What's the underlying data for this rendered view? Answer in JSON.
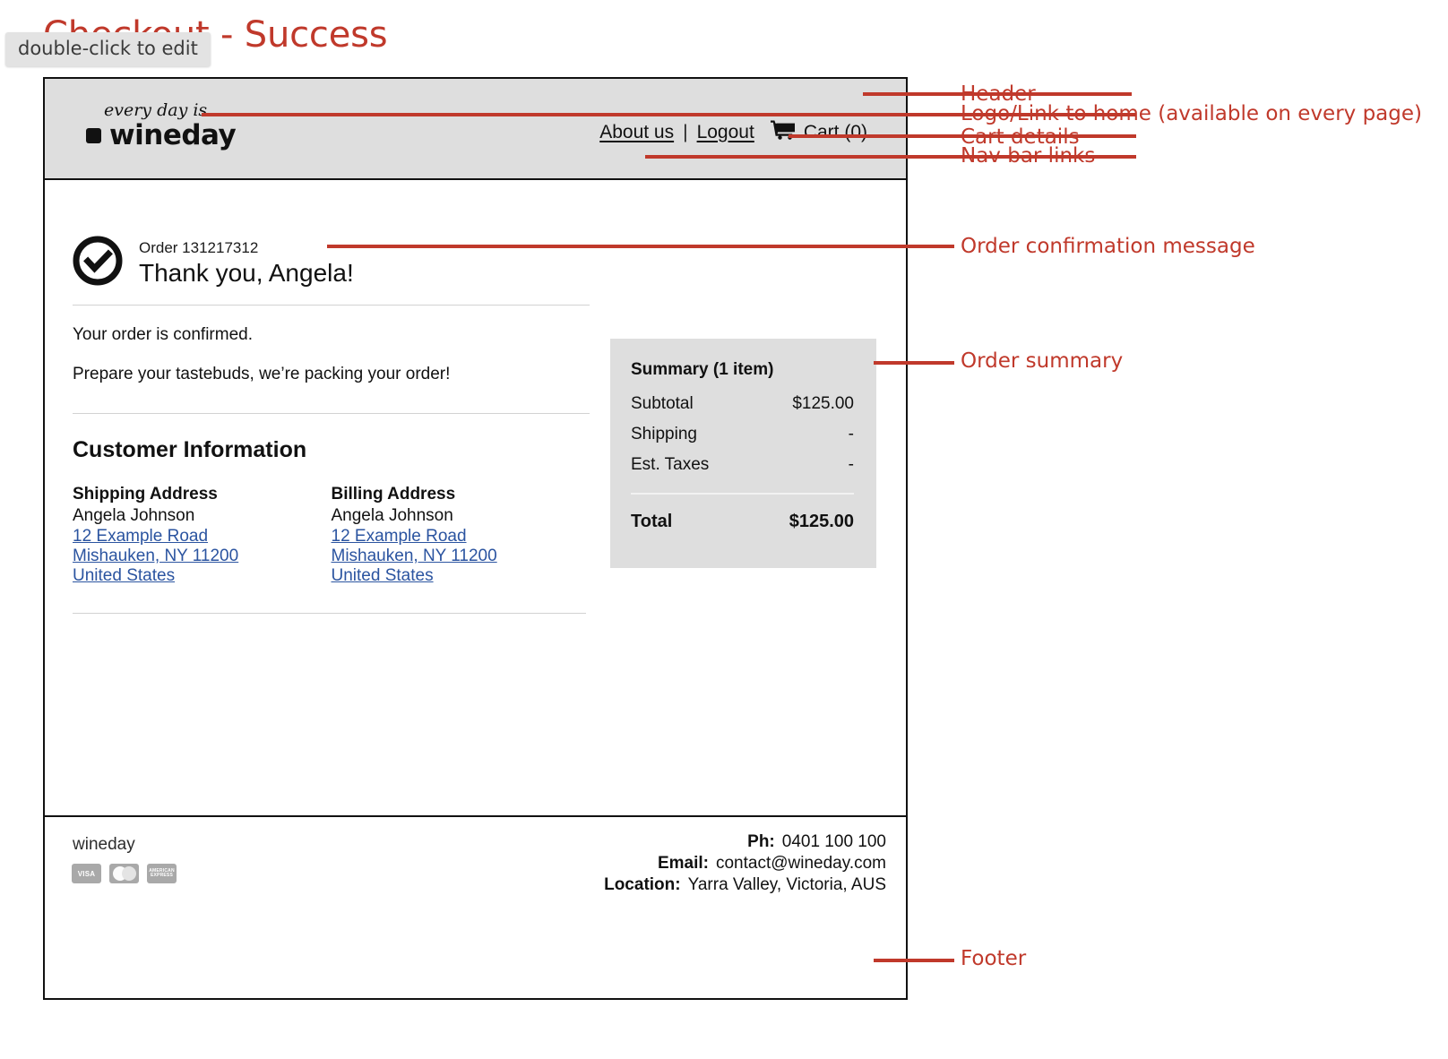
{
  "page": {
    "title": "Checkout - Success",
    "edit_hint": "double-click to edit",
    "accent_color": "#c0392b",
    "header_bg": "#dedede",
    "link_color": "#2b54a0"
  },
  "header": {
    "logo": {
      "tagline": "every day is",
      "wordmark": "wineday",
      "mark": "black-rounded-square"
    },
    "nav": {
      "about_label": "About us",
      "separator": "|",
      "logout_label": "Logout",
      "cart_icon": "shopping-cart-icon",
      "cart_label": "Cart (0)"
    }
  },
  "confirmation": {
    "status_icon": "check-circle-icon",
    "order_number": "Order 131217312",
    "thank_you": "Thank you, Angela!",
    "line_1": "Your order is confirmed.",
    "line_2": "Prepare your tastebuds, we’re packing your order!"
  },
  "summary": {
    "title": "Summary (1 item)",
    "rows": [
      {
        "label": "Subtotal",
        "value": "$125.00"
      },
      {
        "label": "Shipping",
        "value": "-"
      },
      {
        "label": "Est. Taxes",
        "value": "-"
      }
    ],
    "total_label": "Total",
    "total_value": "$125.00"
  },
  "customer": {
    "section_title": "Customer Information",
    "shipping": {
      "title": "Shipping Address",
      "name": "Angela Johnson",
      "line1": "12 Example Road",
      "line2": "Mishauken, NY 11200",
      "line3": "United States"
    },
    "billing": {
      "title": "Billing Address",
      "name": "Angela Johnson",
      "line1": "12 Example Road",
      "line2": "Mishauken, NY 11200",
      "line3": "United States"
    }
  },
  "footer": {
    "brand": "wineday",
    "cards": [
      {
        "name": "visa-card-icon",
        "label": "VISA"
      },
      {
        "name": "mastercard-card-icon",
        "label": ""
      },
      {
        "name": "amex-card-icon",
        "label": "AMERICAN EXPRESS"
      }
    ],
    "contact": [
      {
        "label": "Ph:",
        "value": "0401 100 100"
      },
      {
        "label": "Email:",
        "value": "contact@wineday.com"
      },
      {
        "label": "Location:",
        "value": "Yarra Valley, Victoria, AUS"
      }
    ]
  },
  "annotations": [
    {
      "id": "header",
      "text": "Header"
    },
    {
      "id": "logo",
      "text": "Logo/Link to home (available on every page)"
    },
    {
      "id": "cart",
      "text": "Cart details"
    },
    {
      "id": "nav",
      "text": "Nav bar links"
    },
    {
      "id": "order-confirmation",
      "text": "Order confirmation message"
    },
    {
      "id": "order-summary",
      "text": "Order summary"
    },
    {
      "id": "footer",
      "text": "Footer"
    }
  ]
}
